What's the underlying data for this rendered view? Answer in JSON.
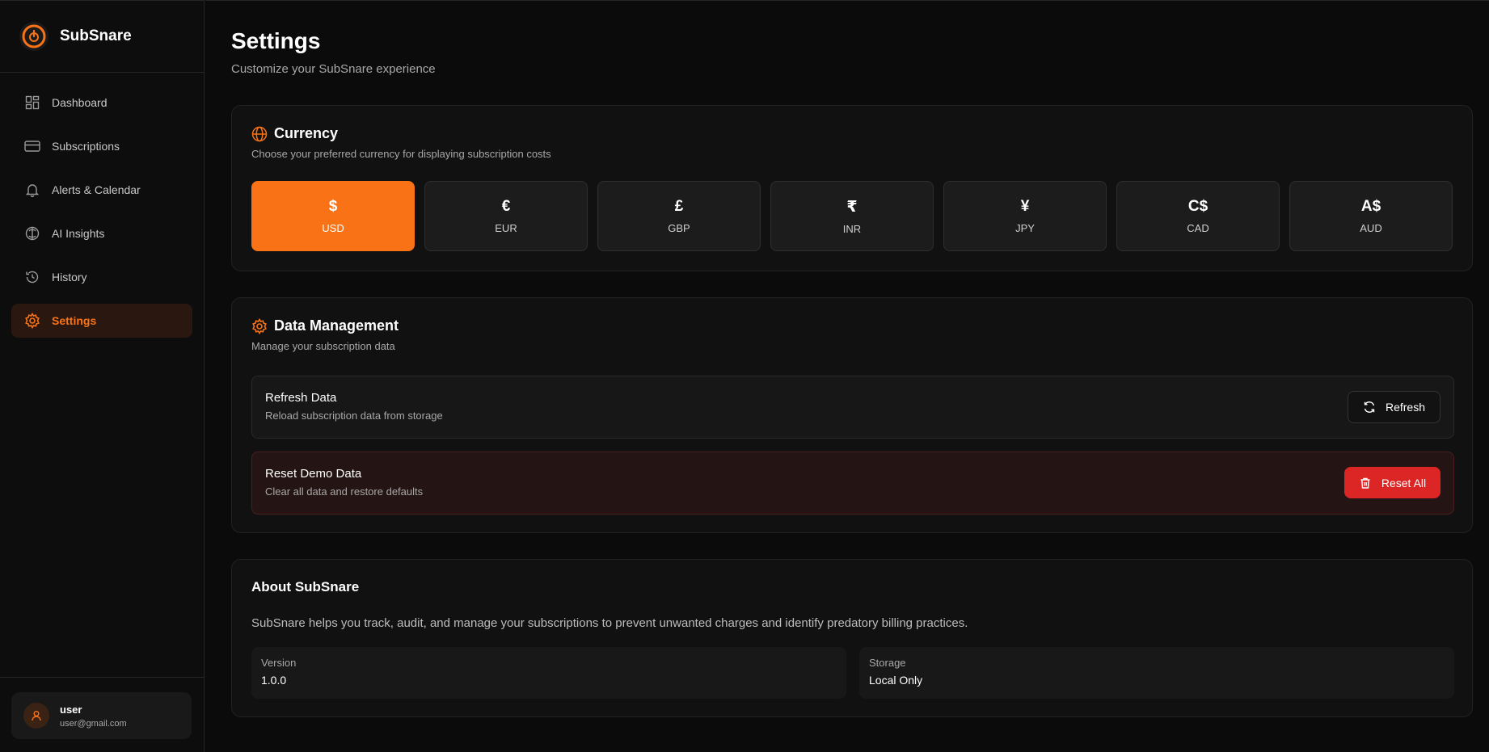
{
  "app": {
    "name": "SubSnare"
  },
  "sidebar": {
    "items": [
      {
        "label": "Dashboard",
        "icon": "dashboard-icon",
        "active": false
      },
      {
        "label": "Subscriptions",
        "icon": "credit-card-icon",
        "active": false
      },
      {
        "label": "Alerts & Calendar",
        "icon": "bell-icon",
        "active": false
      },
      {
        "label": "AI Insights",
        "icon": "brain-icon",
        "active": false
      },
      {
        "label": "History",
        "icon": "history-icon",
        "active": false
      },
      {
        "label": "Settings",
        "icon": "gear-icon",
        "active": true
      }
    ],
    "user": {
      "name": "user",
      "email": "user@gmail.com"
    }
  },
  "page": {
    "title": "Settings",
    "subtitle": "Customize your SubSnare experience"
  },
  "currency": {
    "title": "Currency",
    "description": "Choose your preferred currency for displaying subscription costs",
    "selected": "USD",
    "options": [
      {
        "symbol": "$",
        "code": "USD"
      },
      {
        "symbol": "€",
        "code": "EUR"
      },
      {
        "symbol": "£",
        "code": "GBP"
      },
      {
        "symbol": "₹",
        "code": "INR"
      },
      {
        "symbol": "¥",
        "code": "JPY"
      },
      {
        "symbol": "C$",
        "code": "CAD"
      },
      {
        "symbol": "A$",
        "code": "AUD"
      }
    ]
  },
  "data_management": {
    "title": "Data Management",
    "description": "Manage your subscription data",
    "refresh": {
      "title": "Refresh Data",
      "description": "Reload subscription data from storage",
      "button": "Refresh"
    },
    "reset": {
      "title": "Reset Demo Data",
      "description": "Clear all data and restore defaults",
      "button": "Reset All"
    }
  },
  "about": {
    "title": "About SubSnare",
    "text": "SubSnare helps you track, audit, and manage your subscriptions to prevent unwanted charges and identify predatory billing practices.",
    "version_label": "Version",
    "version_value": "1.0.0",
    "storage_label": "Storage",
    "storage_value": "Local Only"
  },
  "colors": {
    "accent": "#f97316",
    "danger": "#dc2626",
    "background": "#0b0b0b",
    "card": "#111111"
  }
}
